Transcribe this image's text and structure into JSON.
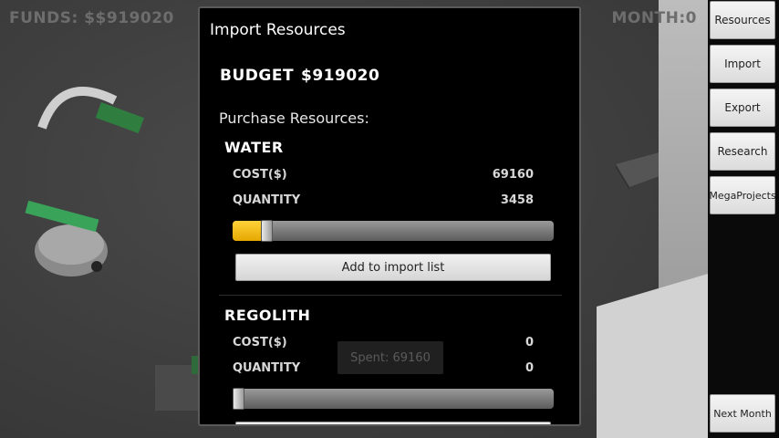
{
  "hud": {
    "funds": "FUNDS: $$919020",
    "month": "MONTH:0"
  },
  "sidebar": {
    "resources": "Resources",
    "import": "Import",
    "export": "Export",
    "research": "Research",
    "megaprojects": "MegaProjects",
    "next_month": "Next Month"
  },
  "dialog": {
    "title": "Import Resources",
    "budget_label": "BUDGET",
    "budget_value": "$919020",
    "purchase_heading": "Purchase Resources:",
    "resources": [
      {
        "name": "WATER",
        "cost_label": "COST($)",
        "cost_value": "69160",
        "quantity_label": "QUANTITY",
        "quantity_value": "3458",
        "slider_fraction": 0.09,
        "add_button": "Add to import list"
      },
      {
        "name": "REGOLITH",
        "cost_label": "COST($)",
        "cost_value": "0",
        "quantity_label": "QUANTITY",
        "quantity_value": "0",
        "slider_fraction": 0.0
      }
    ]
  },
  "toast": {
    "text": "Spent: 69160"
  },
  "colors": {
    "slider_fill": "#f5b800",
    "dialog_bg": "#000000",
    "button_bg": "#e6e6e6"
  }
}
